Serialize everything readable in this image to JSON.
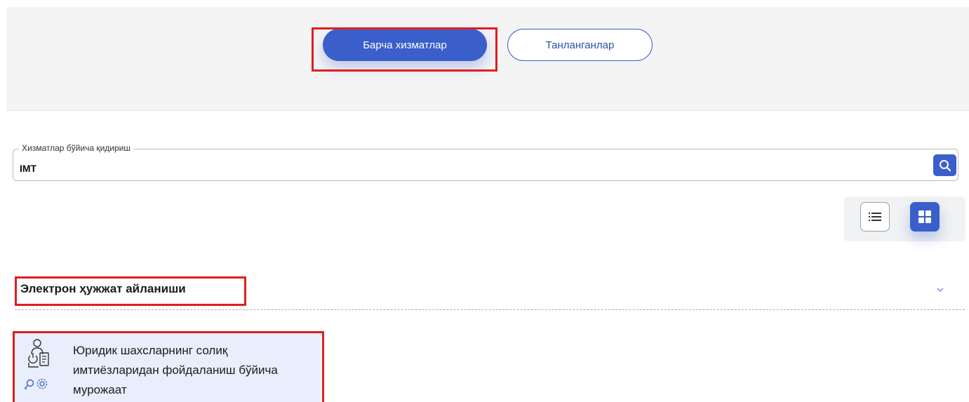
{
  "tabs": {
    "all_services": "Барча хизматлар",
    "favorites": "Танланганлар"
  },
  "search": {
    "label": "Хизматлар бўйича қидириш",
    "value": "IMT",
    "button_icon": "search-icon"
  },
  "view_toggle": {
    "list_icon": "list-view-icon",
    "grid_icon": "grid-view-icon",
    "active": "grid"
  },
  "section": {
    "title": "Электрон ҳужжат айланиши",
    "chevron_icon": "chevron-down-icon"
  },
  "services": [
    {
      "title": "Юридик шахсларнинг солиқ имтиёзларидан фойдаланиш бўйича мурожаат",
      "icon": "legal-entity-service-icon"
    }
  ],
  "colors": {
    "primary": "#3a5fcb",
    "highlight": "#e01e1e",
    "card_bg": "#e8eefb",
    "panel_bg": "#f4f4f5"
  }
}
